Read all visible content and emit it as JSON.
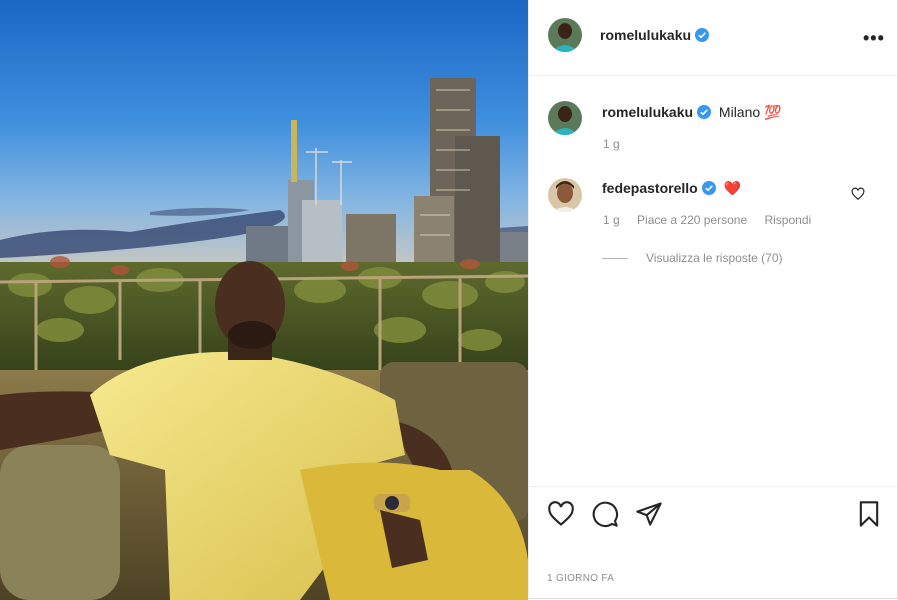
{
  "post": {
    "author": "romelulukaku",
    "more_label": "•••",
    "date": "1 GIORNO FA",
    "photo_description": "Man in yellow t-shirt seated on rooftop sofa in front of a hedge, Milan skyline at dusk"
  },
  "caption": {
    "author": "romelulukaku",
    "text": "Milano",
    "emoji": "💯",
    "time": "1 g"
  },
  "comment": {
    "author": "fedepastorello",
    "emoji": "❤️",
    "time": "1 g",
    "likes": "Piace a 220 persone",
    "reply_label": "Rispondi",
    "view_replies": "Visualizza le risposte (70)"
  },
  "icons": {
    "verified": "verified-badge-icon",
    "heart": "heart-icon",
    "comment": "comment-icon",
    "share": "paper-plane-icon",
    "save": "bookmark-icon"
  },
  "colors": {
    "verified_blue": "#3897f0",
    "muted_text": "#8e8e8e",
    "border": "#dbdbdb"
  }
}
